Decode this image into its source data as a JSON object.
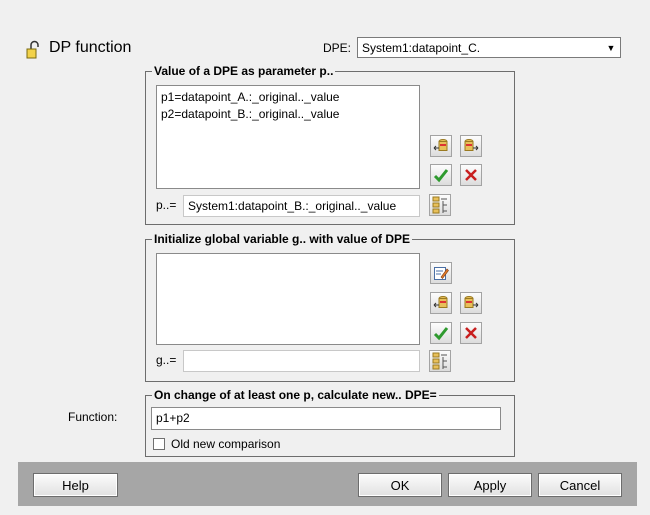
{
  "header": {
    "title": "DP function",
    "title_icon": "lock-icon",
    "dpe_label": "DPE:",
    "dpe_value": "System1:datapoint_C."
  },
  "params": {
    "legend": "Value of a DPE as parameter p..",
    "items": [
      "p1=datapoint_A.:_original.._value",
      "p2=datapoint_B.:_original.._value"
    ],
    "input_label": "p..=",
    "input_value": "System1:datapoint_B.:_original.._value"
  },
  "globals": {
    "legend": "Initialize global variable g.. with value of DPE",
    "items": [],
    "input_label": "g..=",
    "input_value": ""
  },
  "function": {
    "legend": "On change of at least one p, calculate new.. DPE=",
    "label": "Function:",
    "value": "p1+p2",
    "checkbox_label": "Old new comparison",
    "checkbox_checked": false
  },
  "buttons": {
    "help": "Help",
    "ok": "OK",
    "apply": "Apply",
    "cancel": "Cancel"
  },
  "colors": {
    "accept_green": "#2e9a2e",
    "delete_red": "#c81e1e",
    "footer_gray": "#a6a6a6"
  }
}
